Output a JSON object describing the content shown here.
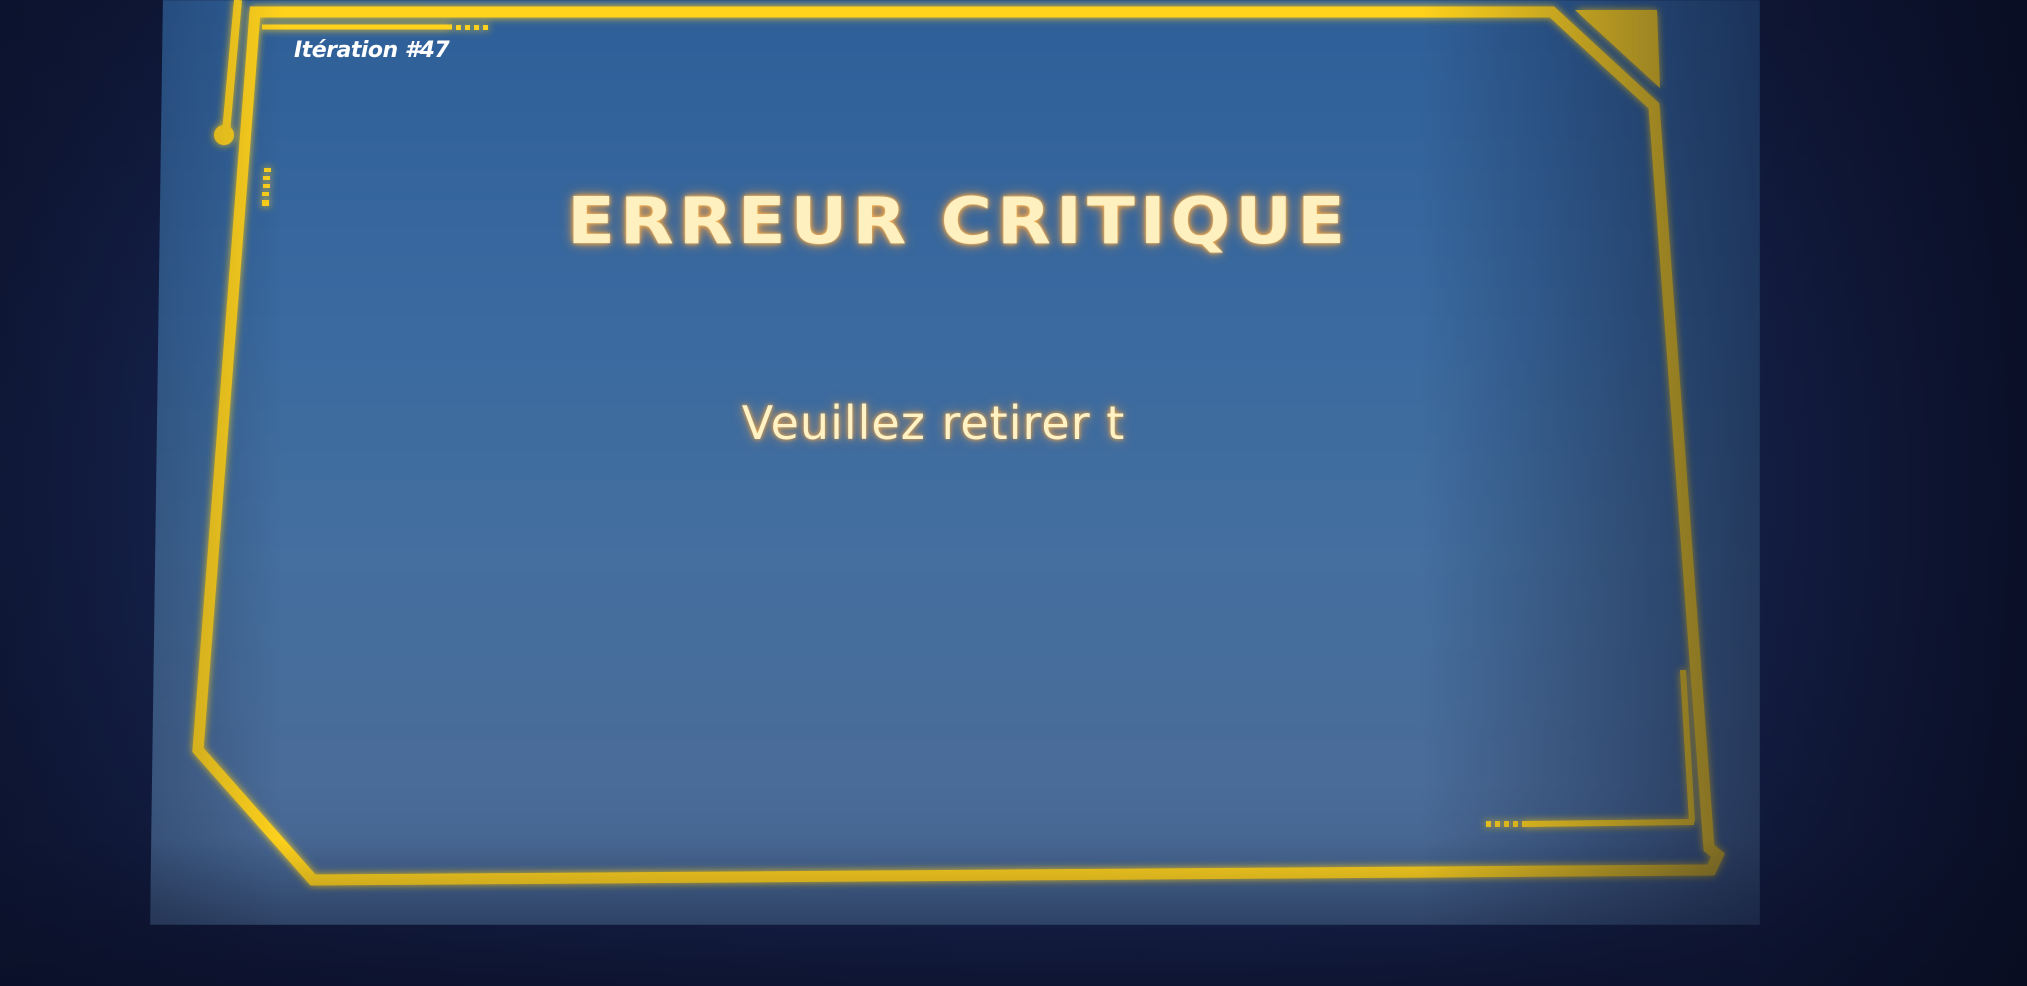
{
  "header": {
    "iteration_label": "Itération #47"
  },
  "dialog": {
    "title": "ERREUR CRITIQUE",
    "message": "Veuillez retirer t"
  },
  "colors": {
    "frame": "#ffd21f",
    "frame_glow": "#ff8a2a",
    "screen_background": "#3a6aa0",
    "text": "#fff0c0"
  }
}
